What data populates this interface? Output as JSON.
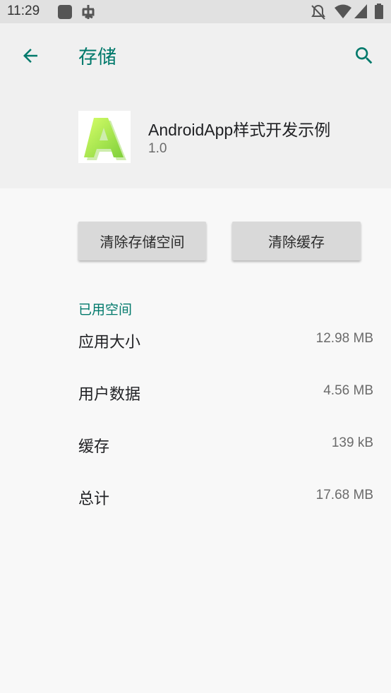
{
  "status_bar": {
    "time": "11:29",
    "icons": [
      "app-square-icon",
      "notification-app-icon",
      "do-not-disturb-off-icon",
      "wifi-icon",
      "cellular-signal-icon",
      "battery-icon"
    ]
  },
  "app_bar": {
    "title": "存储",
    "back_icon": "arrow-back-icon",
    "search_icon": "search-icon",
    "accent_color": "#00796b"
  },
  "app_header": {
    "name": "AndroidApp样式开发示例",
    "version": "1.0",
    "icon": "letter-a-app-icon"
  },
  "buttons": {
    "clear_storage": "清除存储空间",
    "clear_cache": "清除缓存"
  },
  "storage": {
    "section_title": "已用空间",
    "rows": [
      {
        "label": "应用大小",
        "value": "12.98 MB"
      },
      {
        "label": "用户数据",
        "value": "4.56 MB"
      },
      {
        "label": "缓存",
        "value": "139 kB"
      },
      {
        "label": "总计",
        "value": "17.68 MB"
      }
    ]
  }
}
